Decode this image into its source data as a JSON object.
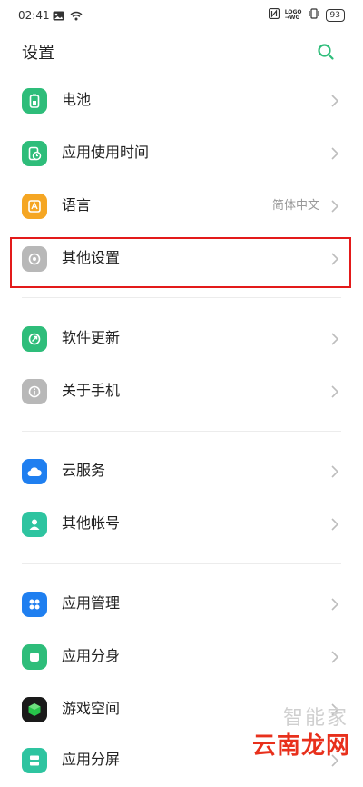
{
  "status": {
    "time": "02:41",
    "right_label": "LOGO\n→WG",
    "battery": "93"
  },
  "header": {
    "title": "设置"
  },
  "items": [
    {
      "label": "电池",
      "icon": "battery-icon",
      "color": "#2ebd7a"
    },
    {
      "label": "应用使用时间",
      "icon": "app-usage-icon",
      "color": "#2ebd7a"
    },
    {
      "label": "语言",
      "value": "简体中文",
      "icon": "language-icon",
      "color": "#f5a623"
    },
    {
      "label": "其他设置",
      "icon": "other-settings-icon",
      "color": "#b8b8b8"
    },
    {
      "label": "软件更新",
      "icon": "software-update-icon",
      "color": "#2ebd7a"
    },
    {
      "label": "关于手机",
      "icon": "about-phone-icon",
      "color": "#b8b8b8"
    },
    {
      "label": "云服务",
      "icon": "cloud-icon",
      "color": "#1f7ff0"
    },
    {
      "label": "其他帐号",
      "icon": "account-icon",
      "color": "#2ec4a0"
    },
    {
      "label": "应用管理",
      "icon": "app-management-icon",
      "color": "#1f7ff0"
    },
    {
      "label": "应用分身",
      "icon": "app-clone-icon",
      "color": "#2ebd7a"
    },
    {
      "label": "游戏空间",
      "icon": "game-space-icon",
      "color": "#1a1a1a"
    },
    {
      "label": "应用分屏",
      "icon": "split-screen-icon",
      "color": "#2ec4a0"
    }
  ],
  "watermark": {
    "top": "智能家",
    "bottom": "云南龙网"
  }
}
